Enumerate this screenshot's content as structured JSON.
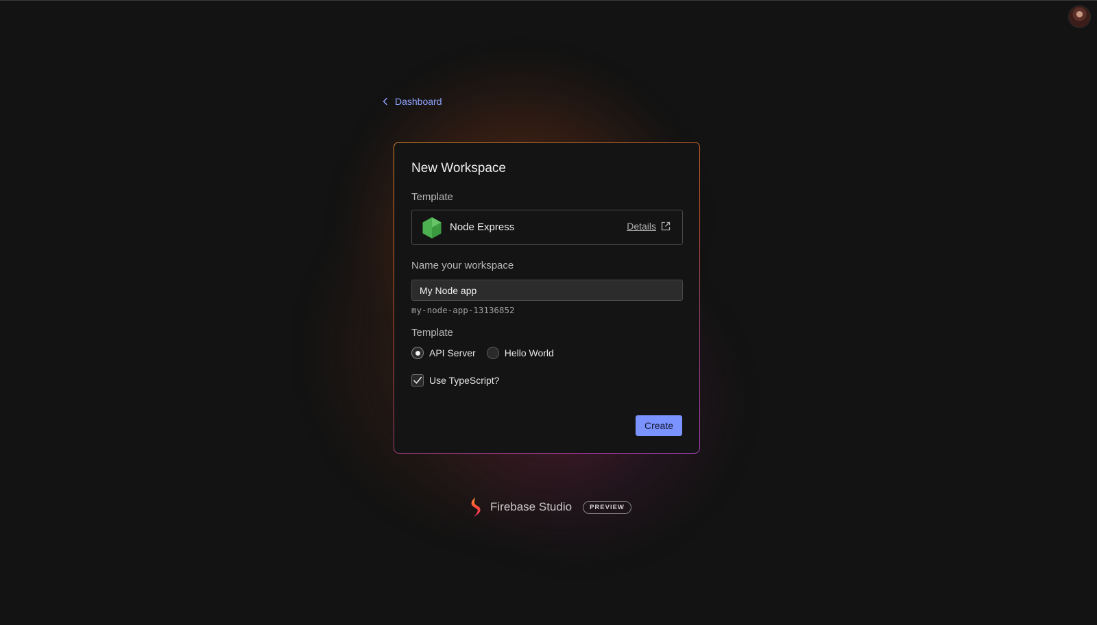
{
  "nav": {
    "back_label": "Dashboard"
  },
  "card": {
    "title": "New Workspace",
    "template_section_label": "Template",
    "template": {
      "name": "Node Express",
      "details_label": "Details"
    },
    "name_section_label": "Name your workspace",
    "name_input": {
      "value": "My Node app",
      "placeholder": ""
    },
    "slug": "my-node-app-13136852",
    "variant_section_label": "Template",
    "variants": [
      {
        "label": "API Server",
        "checked": true
      },
      {
        "label": "Hello World",
        "checked": false
      }
    ],
    "typescript": {
      "label": "Use TypeScript?",
      "checked": true
    },
    "create_label": "Create"
  },
  "brand": {
    "name": "Firebase Studio",
    "badge": "PREVIEW"
  },
  "colors": {
    "accent": "#7b93ff",
    "link": "#8fa3ff",
    "background": "#131313",
    "node_green": "#4caf50"
  },
  "icons": {
    "back": "chevron-left-icon",
    "template": "node-hexagon-icon",
    "details": "external-link-icon",
    "check": "checkmark-icon",
    "brand": "firebase-studio-logo-icon"
  }
}
